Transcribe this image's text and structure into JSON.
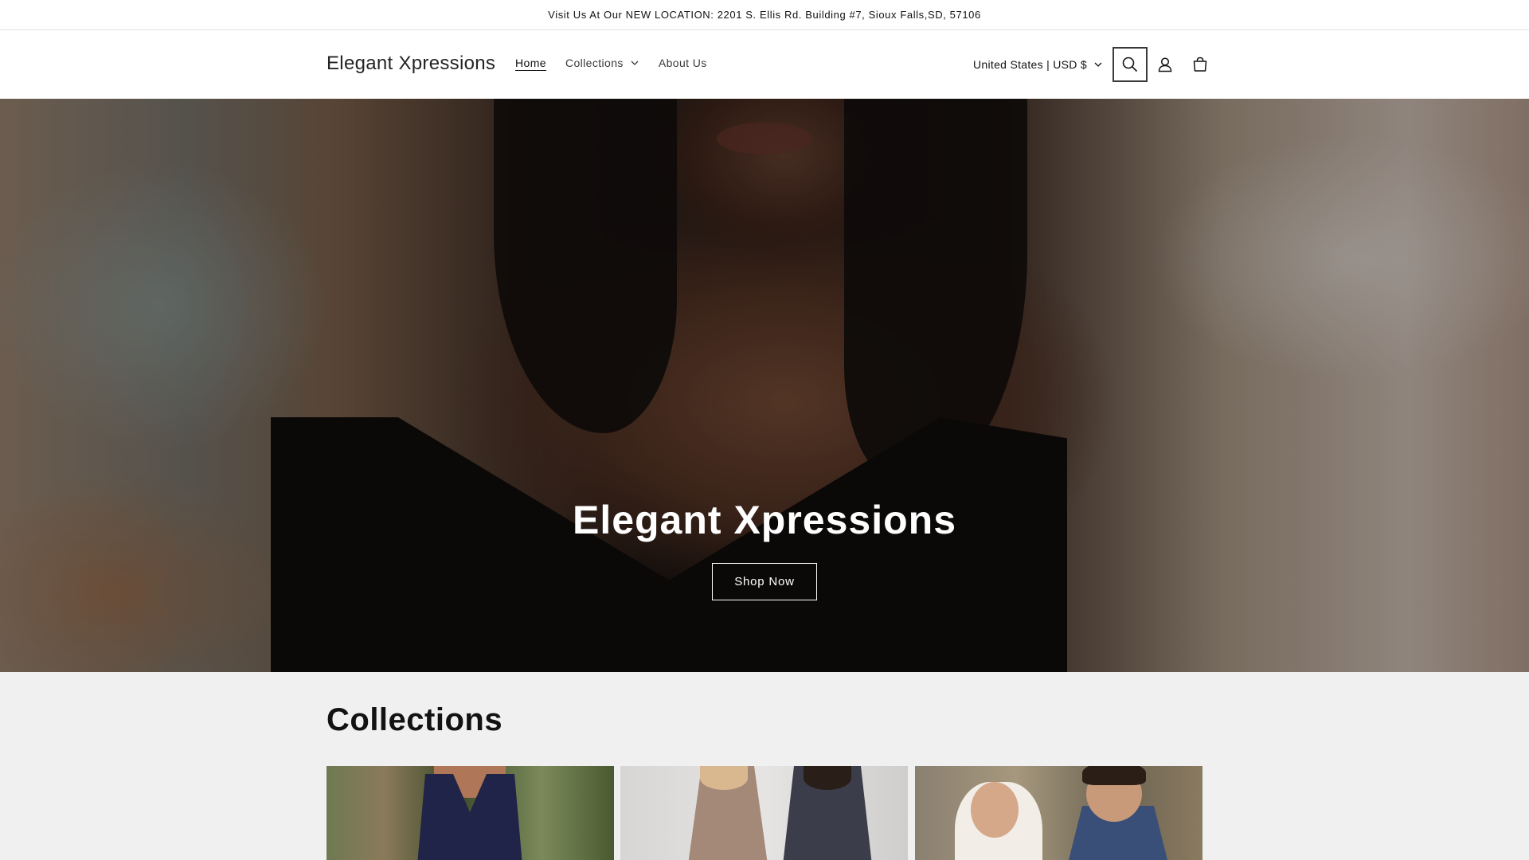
{
  "announcement": {
    "text": "Visit Us At Our NEW LOCATION: 2201 S. Ellis Rd. Building #7, Sioux Falls,SD, 57106"
  },
  "header": {
    "logo": "Elegant Xpressions",
    "nav": [
      {
        "label": "Home",
        "active": true,
        "has_dropdown": false
      },
      {
        "label": "Collections",
        "active": false,
        "has_dropdown": true
      },
      {
        "label": "About Us",
        "active": false,
        "has_dropdown": false
      }
    ],
    "localization": "United States | USD $",
    "icons": [
      "search-icon",
      "account-icon",
      "cart-icon"
    ]
  },
  "hero": {
    "title": "Elegant Xpressions",
    "button_label": "Shop Now"
  },
  "collections": {
    "title": "Collections",
    "cards": [
      {
        "image": "navy-evening-gown"
      },
      {
        "image": "beaded-mother-of-bride-dresses"
      },
      {
        "image": "wedding-couple-navy-tuxedo"
      }
    ]
  },
  "colors": {
    "text": "#121212",
    "background": "#ffffff",
    "collections_bg": "#f0f0f0",
    "button_border": "#ffffff"
  }
}
